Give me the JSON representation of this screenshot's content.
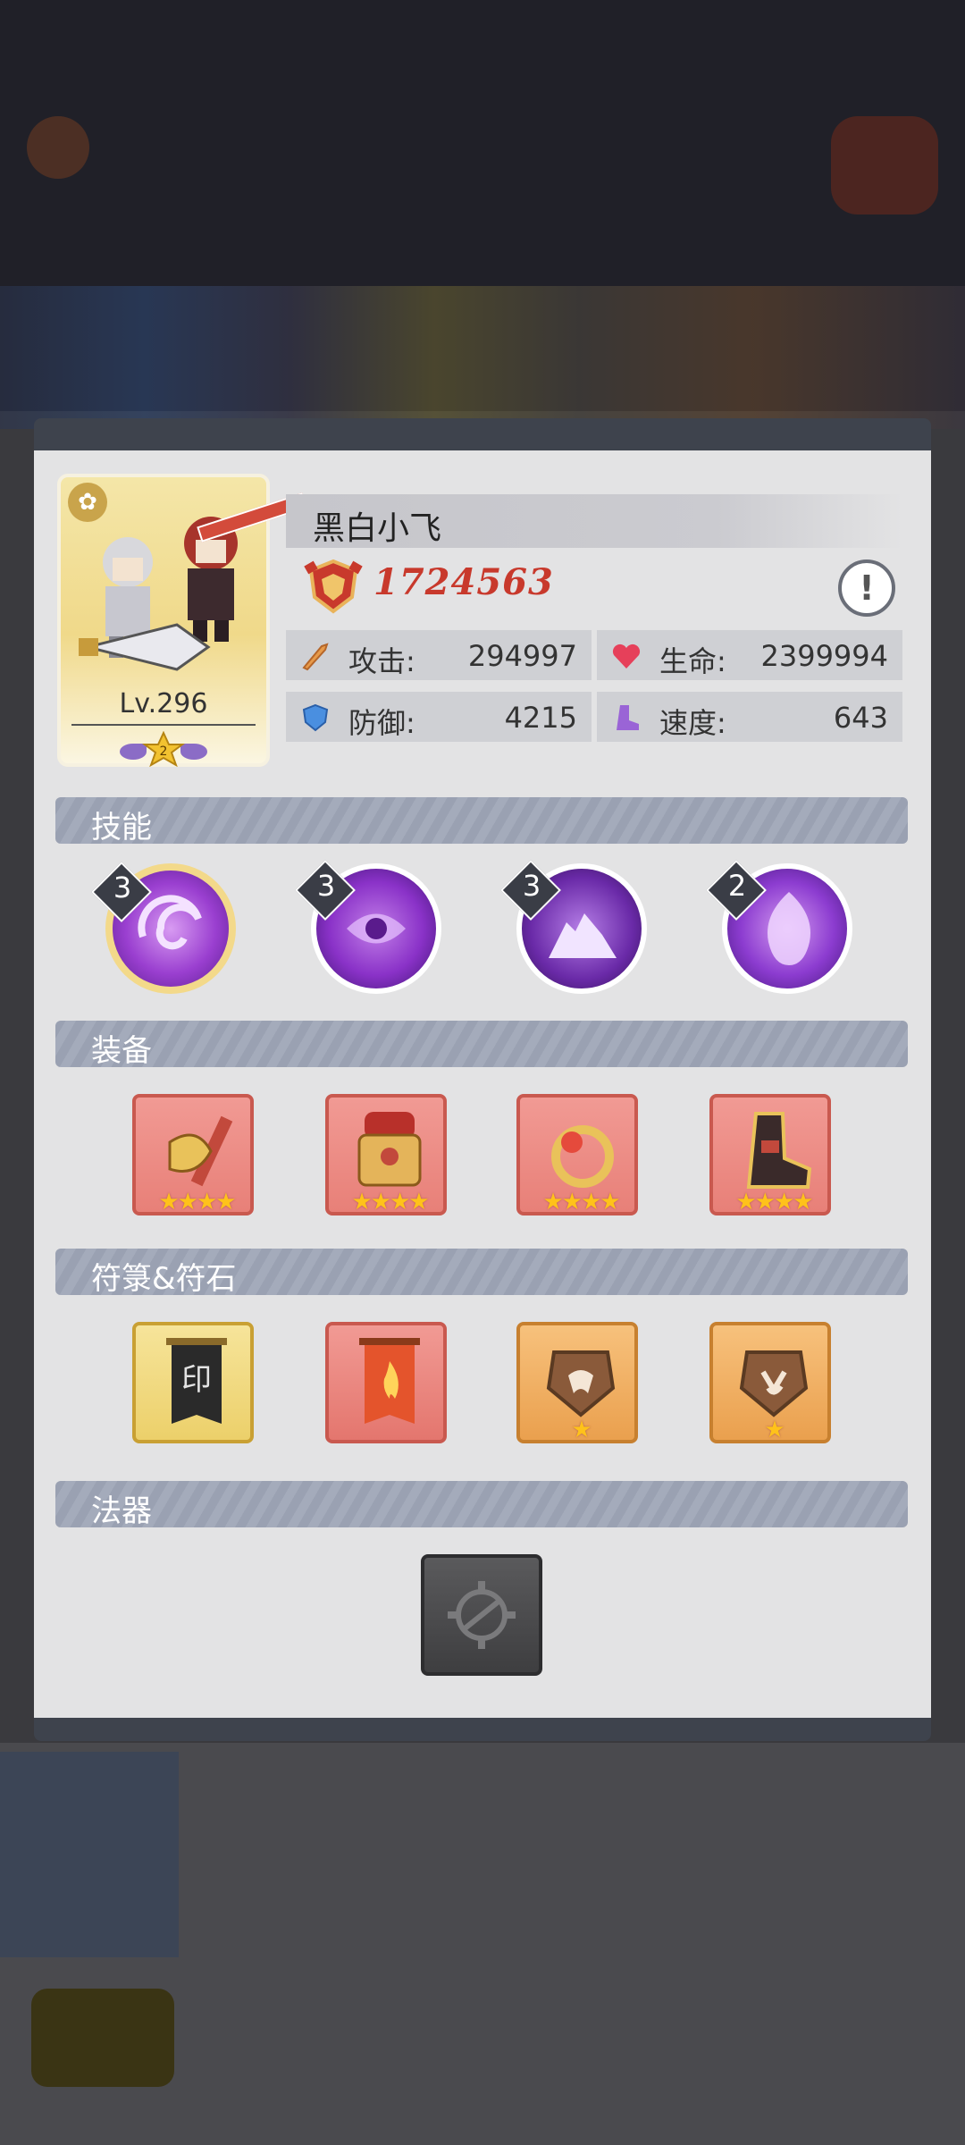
{
  "player": {
    "name": "黑白小飞",
    "level": "Lv.296",
    "star_count": "2",
    "power": "1724563"
  },
  "stats": {
    "attack": {
      "label": "攻击:",
      "value": "294997"
    },
    "hp": {
      "label": "生命:",
      "value": "2399994"
    },
    "defense": {
      "label": "防御:",
      "value": "4215"
    },
    "speed": {
      "label": "速度:",
      "value": "643"
    }
  },
  "sections": {
    "skills": "技能",
    "equipment": "装备",
    "talismans": "符箓&符石",
    "artifact": "法器"
  },
  "skills": [
    {
      "level": "3",
      "icon": "purple-vortex-icon"
    },
    {
      "level": "3",
      "icon": "purple-yin-yang-icon"
    },
    {
      "level": "3",
      "icon": "purple-beast-icon"
    },
    {
      "level": "2",
      "icon": "purple-flame-spirit-icon"
    }
  ],
  "equipment": [
    {
      "icon": "axe-weapon-icon",
      "stars": "★★★★"
    },
    {
      "icon": "armor-icon",
      "stars": "★★★★"
    },
    {
      "icon": "ring-icon",
      "stars": "★★★★"
    },
    {
      "icon": "boots-icon",
      "stars": "★★★★"
    }
  ],
  "talismans": [
    {
      "icon": "black-banner-talisman-icon",
      "stars": ""
    },
    {
      "icon": "fire-banner-talisman-icon",
      "stars": ""
    },
    {
      "icon": "rune-stone-icon",
      "stars": "★"
    },
    {
      "icon": "rune-stone-icon",
      "stars": "★"
    }
  ],
  "colors": {
    "power_red": "#c8392c",
    "section_header": "#9aa1b2",
    "dialog_bg": "#e3e3e4",
    "star_gold": "#ffc21a"
  }
}
